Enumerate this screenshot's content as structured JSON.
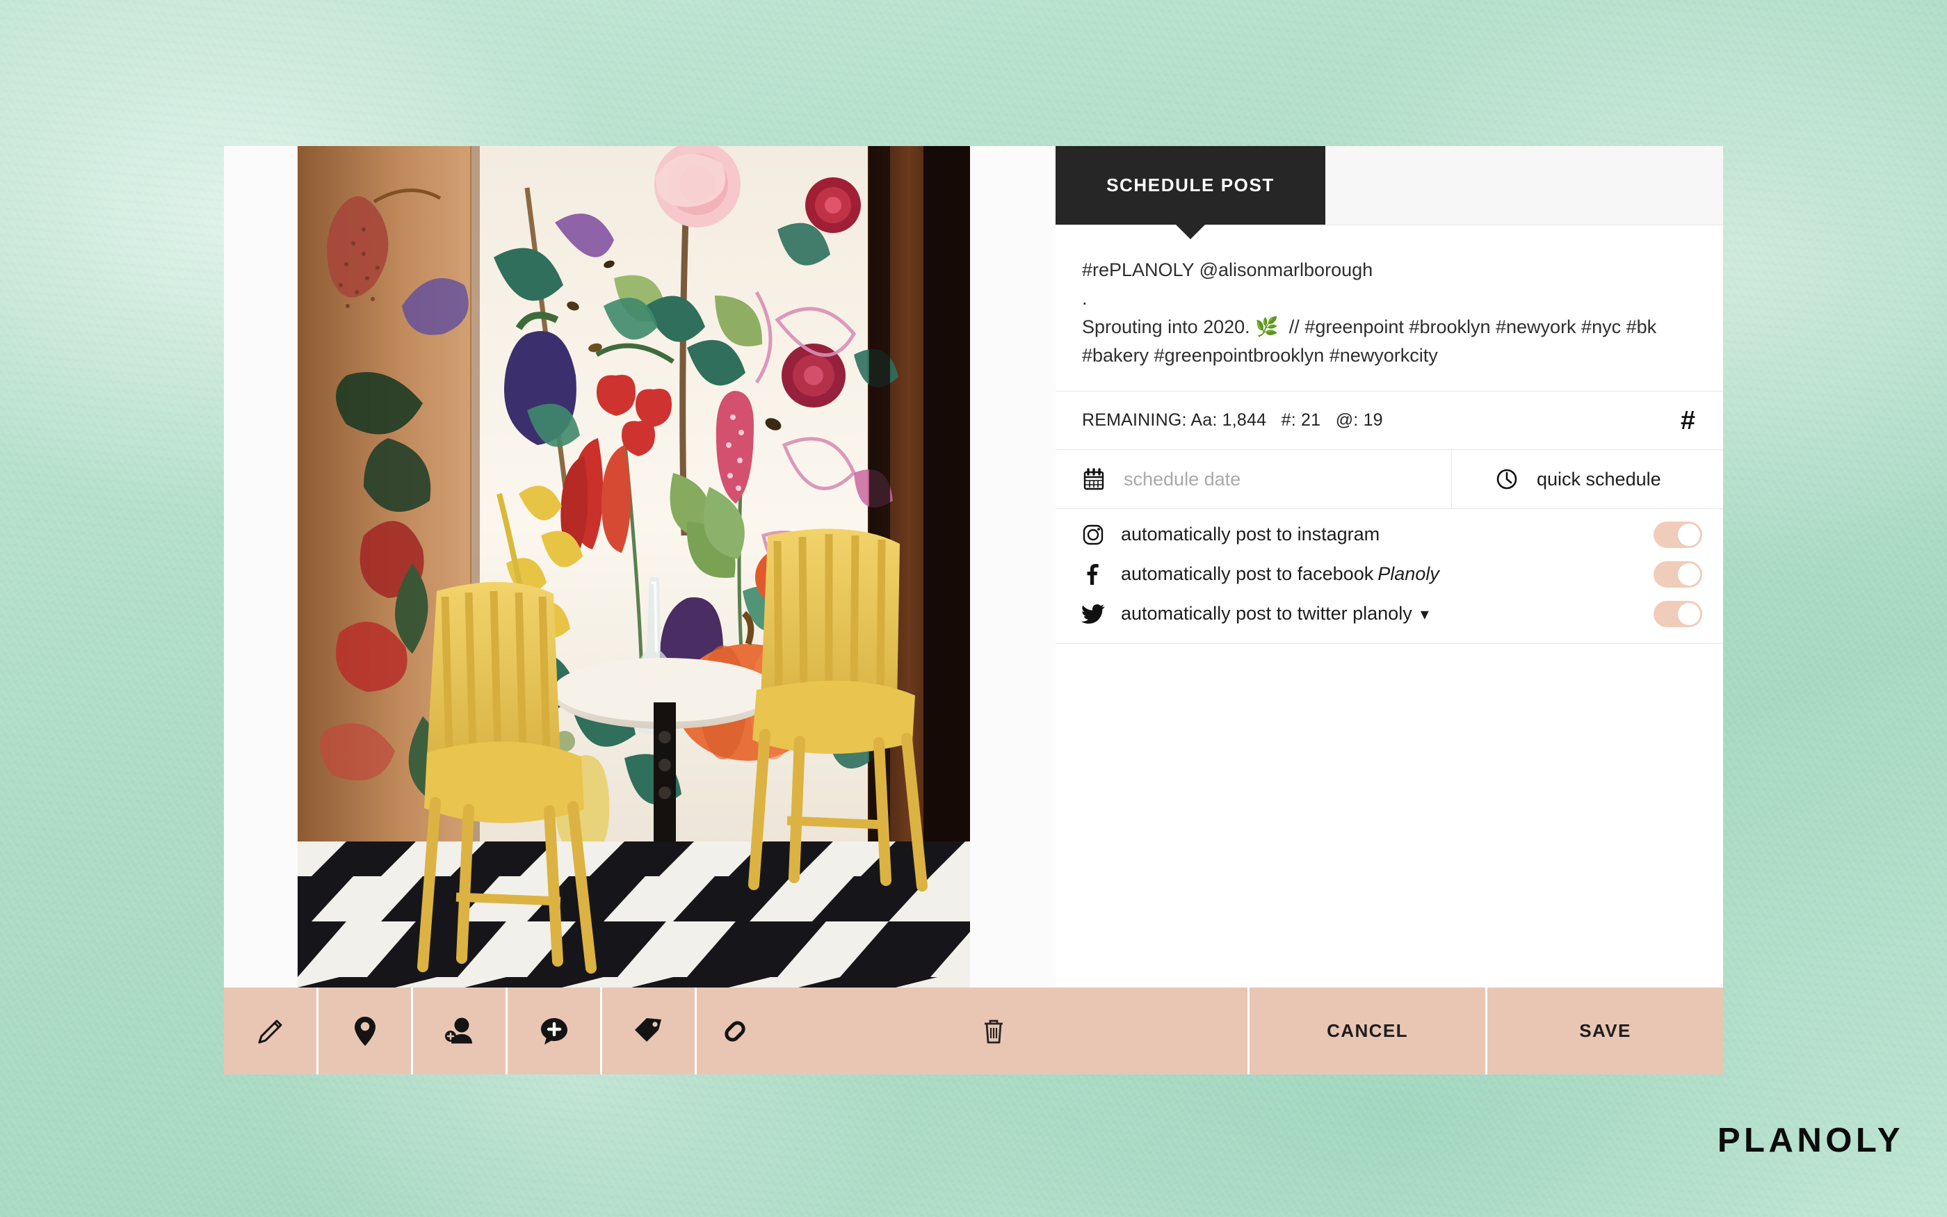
{
  "background": {
    "color": "#aedcc6",
    "style": "mint-watercolor"
  },
  "card": {
    "background": "#ffffff"
  },
  "panel": {
    "tab": {
      "label": "SCHEDULE POST",
      "background": "#262626",
      "text_color": "#ffffff"
    },
    "caption": {
      "text": "#rePLANOLY @alisonmarlborough\n.\nSprouting into 2020. 🌿  // #greenpoint #brooklyn #newyork #nyc #bk #bakery #greenpointbrooklyn #newyorkcity"
    },
    "counter": {
      "text": "REMAINING: Aa: 1,844   #: 21   @: 19",
      "label": "REMAINING:",
      "characters_remaining": "1,844",
      "hashtags_remaining": "21",
      "mentions_remaining": "19",
      "hashtag_button": "#"
    },
    "schedule": {
      "date_placeholder": "schedule date",
      "date_value": "",
      "date_icon": "calendar-icon",
      "quick_label": "quick schedule",
      "quick_icon": "clock-icon"
    },
    "autopost": [
      {
        "icon": "instagram-icon",
        "label": "automatically post to instagram",
        "page": "",
        "has_dropdown": false,
        "toggle_on": true
      },
      {
        "icon": "facebook-icon",
        "label": "automatically post to facebook",
        "page": "Planoly",
        "has_dropdown": false,
        "toggle_on": true
      },
      {
        "icon": "twitter-icon",
        "label": "automatically post to twitter planoly",
        "page": "",
        "has_dropdown": true,
        "dropdown_icon": "chevron-down-icon",
        "toggle_on": true
      }
    ],
    "toggle_colors": {
      "track": "#efcdba",
      "knob": "#ffffff"
    }
  },
  "toolbar": {
    "background": "#e9c6b4",
    "tools": [
      {
        "name": "edit",
        "icon": "pencil-icon"
      },
      {
        "name": "location",
        "icon": "location-pin-icon"
      },
      {
        "name": "tag-user",
        "icon": "add-person-icon"
      },
      {
        "name": "comment",
        "icon": "comment-plus-icon"
      },
      {
        "name": "product-tag",
        "icon": "price-tag-icon"
      },
      {
        "name": "link",
        "icon": "link-icon"
      },
      {
        "name": "delete",
        "icon": "trash-icon"
      }
    ],
    "cancel_label": "CANCEL",
    "save_label": "SAVE"
  },
  "photo": {
    "alt": "cafe corner with botanical floral mural wallpaper, yellow wooden chairs, round marble bistro table with glass vase, black and white checkered tile floor"
  },
  "brand": {
    "logo_text": "PLANOLY"
  }
}
